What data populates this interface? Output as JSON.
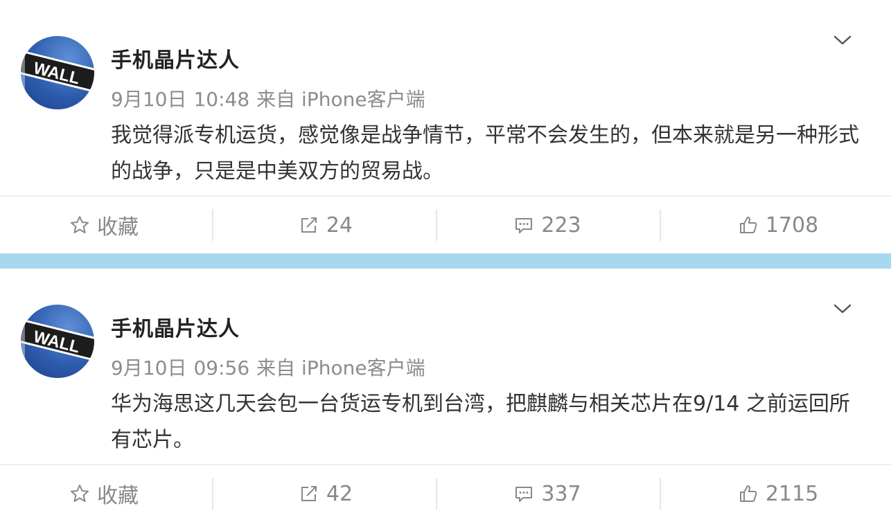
{
  "posts": [
    {
      "username": "手机晶片达人",
      "date": "9月10日",
      "time": "10:48",
      "source": "来自 iPhone客户端",
      "content": "我觉得派专机运货，感觉像是战争情节，平常不会发生的，但本来就是另一种形式的战争，只是是中美双方的贸易战。",
      "actions": {
        "favorite": "收藏",
        "repost": "24",
        "comment": "223",
        "like": "1708"
      },
      "avatar_text": "WALL"
    },
    {
      "username": "手机晶片达人",
      "date": "9月10日",
      "time": "09:56",
      "source": "来自 iPhone客户端",
      "content": "华为海思这几天会包一台货运专机到台湾，把麒麟与相关芯片在9/14 之前运回所有芯片。",
      "actions": {
        "favorite": "收藏",
        "repost": "42",
        "comment": "337",
        "like": "2115"
      },
      "avatar_text": "WALL"
    }
  ],
  "icons": {
    "more": "chevron-down-icon",
    "favorite": "star-icon",
    "repost": "repost-icon",
    "comment": "comment-icon",
    "like": "thumbs-up-icon"
  },
  "colors": {
    "separator_band": "#a8d8f0",
    "meta_text": "#8c8c8c",
    "action_text": "#888888"
  }
}
